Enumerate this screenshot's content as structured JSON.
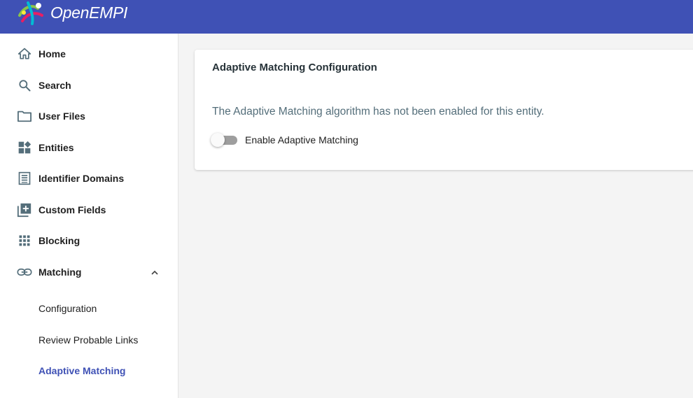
{
  "app": {
    "title": "OpenEMPI"
  },
  "sidebar": {
    "items": [
      {
        "label": "Home",
        "icon": "home-icon"
      },
      {
        "label": "Search",
        "icon": "search-icon"
      },
      {
        "label": "User Files",
        "icon": "folder-icon"
      },
      {
        "label": "Entities",
        "icon": "widgets-icon"
      },
      {
        "label": "Identifier Domains",
        "icon": "list-icon"
      },
      {
        "label": "Custom Fields",
        "icon": "library-add-icon"
      },
      {
        "label": "Blocking",
        "icon": "apps-grid-icon"
      },
      {
        "label": "Matching",
        "icon": "link-icon",
        "expanded": true
      }
    ],
    "matching_sub": [
      {
        "label": "Configuration"
      },
      {
        "label": "Review Probable Links"
      },
      {
        "label": "Adaptive Matching",
        "active": true
      }
    ]
  },
  "card": {
    "title": "Adaptive Matching Configuration",
    "message": "The Adaptive Matching algorithm has not been enabled for this entity.",
    "toggle_label": "Enable Adaptive Matching",
    "toggle_on": false
  },
  "colors": {
    "primary": "#3f51b5",
    "active_text": "#3f51b5",
    "toggle_off": "#9e9e9e"
  }
}
